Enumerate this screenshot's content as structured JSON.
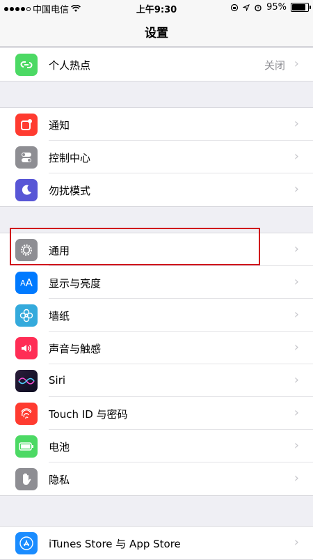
{
  "status": {
    "carrier": "中国电信",
    "time": "上午9:30",
    "battery": "95%",
    "battery_level": 0.95
  },
  "nav": {
    "title": "设置"
  },
  "groups": [
    {
      "rows": [
        {
          "label": "个人热点",
          "value": "关闭",
          "icon": "hotspot-icon",
          "color": "#4cd964"
        }
      ]
    },
    {
      "rows": [
        {
          "label": "通知",
          "icon": "notifications-icon",
          "color": "#ff3b30"
        },
        {
          "label": "控制中心",
          "icon": "control-center-icon",
          "color": "#8e8e93"
        },
        {
          "label": "勿扰模式",
          "icon": "moon-icon",
          "color": "#5856d6"
        }
      ]
    },
    {
      "rows": [
        {
          "label": "通用",
          "icon": "gear-icon",
          "color": "#8e8e93"
        },
        {
          "label": "显示与亮度",
          "icon": "display-icon",
          "color": "#007aff"
        },
        {
          "label": "墙纸",
          "icon": "wallpaper-icon",
          "color": "#34aadc"
        },
        {
          "label": "声音与触感",
          "icon": "sound-icon",
          "color": "#ff2d55"
        },
        {
          "label": "Siri",
          "icon": "siri-icon",
          "color": "#1c1c1e"
        },
        {
          "label": "Touch ID 与密码",
          "icon": "fingerprint-icon",
          "color": "#ff3b30"
        },
        {
          "label": "电池",
          "icon": "battery-icon",
          "color": "#4cd964"
        },
        {
          "label": "隐私",
          "icon": "hand-icon",
          "color": "#8e8e93"
        }
      ]
    },
    {
      "rows": [
        {
          "label": "iTunes Store 与 App Store",
          "icon": "app-store-icon",
          "color": "#1a8cff"
        }
      ]
    }
  ]
}
